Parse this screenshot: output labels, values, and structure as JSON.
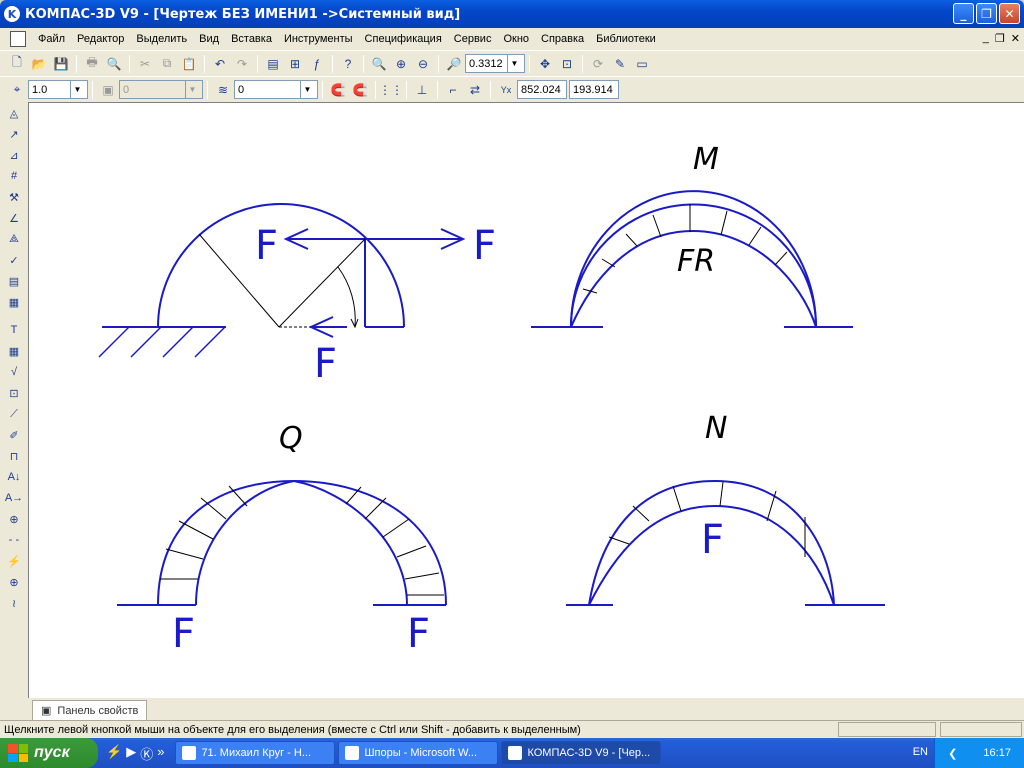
{
  "window": {
    "title": "КОМПАС-3D V9 - [Чертеж БЕЗ ИМЕНИ1 ->Системный вид]"
  },
  "menu": [
    "Файл",
    "Редактор",
    "Выделить",
    "Вид",
    "Вставка",
    "Инструменты",
    "Спецификация",
    "Сервис",
    "Окно",
    "Справка",
    "Библиотеки"
  ],
  "toolbar": {
    "zoom_value": "0.3312",
    "step_value": "1.0",
    "state_value": "0",
    "layer_value": "0",
    "coord_x": "852.024",
    "coord_y": "193.914"
  },
  "drawing": {
    "labels": {
      "f_top_left": "F",
      "f_top_right": "F",
      "f_bottom": "F",
      "m": "M",
      "fr": "FR",
      "q": "Q",
      "q_f_left": "F",
      "q_f_right": "F",
      "n": "N",
      "n_f": "F"
    },
    "line_color": "#1a1ac8",
    "thin_color": "#000000"
  },
  "panel": {
    "tab_label": "Панель свойств"
  },
  "status": {
    "text": "Щелкните левой кнопкой мыши на объекте для его выделения (вместе с Ctrl или Shift - добавить к выделенным)"
  },
  "taskbar": {
    "start_label": "пуск",
    "tasks": [
      "71. Михаил Круг - Н...",
      "Шпоры - Microsoft W...",
      "КОМПАС-3D V9 - [Чер..."
    ],
    "lang": "EN",
    "clock": "16:17"
  }
}
